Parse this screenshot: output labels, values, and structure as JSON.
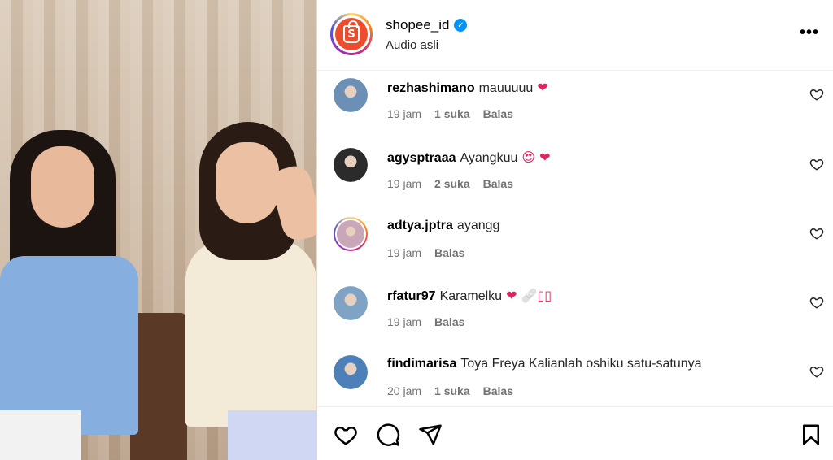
{
  "header": {
    "username": "shopee_id",
    "subtitle": "Audio asli",
    "more_label": "•••"
  },
  "comments": [
    {
      "user": "rezhashimano",
      "text": "mauuuuu",
      "emoji": "❤",
      "time": "19 jam",
      "likes": "1 suka",
      "reply": "Balas",
      "avatar_color": "#6b8fb5",
      "ring": false
    },
    {
      "user": "agysptraaa",
      "text": "Ayangkuu",
      "emoji": "😍 ❤",
      "time": "19 jam",
      "likes": "2 suka",
      "reply": "Balas",
      "avatar_color": "#2b2b2b",
      "ring": false
    },
    {
      "user": "adtya.jptra",
      "text": "ayangg",
      "emoji": "",
      "time": "19 jam",
      "likes": "",
      "reply": "Balas",
      "avatar_color": "#c9a6b8",
      "ring": true
    },
    {
      "user": "rfatur97",
      "text": "Karamelku",
      "emoji": "❤ 🩹▯▯",
      "time": "19 jam",
      "likes": "",
      "reply": "Balas",
      "avatar_color": "#7fa3c4",
      "ring": false
    },
    {
      "user": "findimarisa",
      "text": "Toya Freya Kalianlah oshiku satu-satunya",
      "emoji": "",
      "time": "20 jam",
      "likes": "1 suka",
      "reply": "Balas",
      "avatar_color": "#4d7fb8",
      "ring": false
    }
  ],
  "footer": {
    "icons": [
      "heart-icon",
      "comment-icon",
      "share-icon",
      "bookmark-icon"
    ]
  },
  "colors": {
    "shopee": "#ee4d2d",
    "verified": "#0095f6",
    "heart": "#e0245e"
  }
}
